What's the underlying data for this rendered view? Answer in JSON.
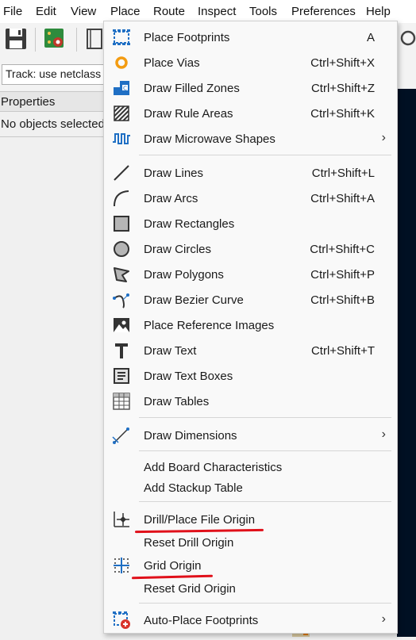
{
  "menubar": {
    "items": [
      {
        "label": "File"
      },
      {
        "label": "Edit"
      },
      {
        "label": "View"
      },
      {
        "label": "Place"
      },
      {
        "label": "Route"
      },
      {
        "label": "Inspect"
      },
      {
        "label": "Tools"
      },
      {
        "label": "Preferences"
      },
      {
        "label": "Help"
      }
    ]
  },
  "track": {
    "value": "Track: use netclass width"
  },
  "properties": {
    "title": "Properties",
    "empty_text": "No objects selected"
  },
  "place_menu": {
    "items": [
      {
        "label": "Place Footprints",
        "shortcut": "A",
        "icon": "footprint-icon"
      },
      {
        "label": "Place Vias",
        "shortcut": "Ctrl+Shift+X",
        "icon": "via-icon"
      },
      {
        "label": "Draw Filled Zones",
        "shortcut": "Ctrl+Shift+Z",
        "icon": "filled-zone-icon"
      },
      {
        "label": "Draw Rule Areas",
        "shortcut": "Ctrl+Shift+K",
        "icon": "rule-area-icon"
      },
      {
        "label": "Draw Microwave Shapes",
        "submenu": true,
        "icon": "microwave-icon"
      },
      {
        "label": "Draw Lines",
        "shortcut": "Ctrl+Shift+L",
        "icon": "line-icon"
      },
      {
        "label": "Draw Arcs",
        "shortcut": "Ctrl+Shift+A",
        "icon": "arc-icon"
      },
      {
        "label": "Draw Rectangles",
        "shortcut": "",
        "icon": "rectangle-icon"
      },
      {
        "label": "Draw Circles",
        "shortcut": "Ctrl+Shift+C",
        "icon": "circle-icon"
      },
      {
        "label": "Draw Polygons",
        "shortcut": "Ctrl+Shift+P",
        "icon": "polygon-icon"
      },
      {
        "label": "Draw Bezier Curve",
        "shortcut": "Ctrl+Shift+B",
        "icon": "bezier-icon"
      },
      {
        "label": "Place Reference Images",
        "shortcut": "",
        "icon": "image-icon"
      },
      {
        "label": "Draw Text",
        "shortcut": "Ctrl+Shift+T",
        "icon": "text-icon"
      },
      {
        "label": "Draw Text Boxes",
        "shortcut": "",
        "icon": "text-box-icon"
      },
      {
        "label": "Draw Tables",
        "shortcut": "",
        "icon": "table-icon"
      },
      {
        "label": "Draw Dimensions",
        "submenu": true,
        "icon": "dimension-icon"
      },
      {
        "label": "Add Board Characteristics",
        "shortcut": ""
      },
      {
        "label": "Add Stackup Table",
        "shortcut": ""
      },
      {
        "label": "Drill/Place File Origin",
        "shortcut": "",
        "icon": "drill-origin-icon"
      },
      {
        "label": "Reset Drill Origin",
        "shortcut": ""
      },
      {
        "label": "Grid Origin",
        "shortcut": "",
        "icon": "grid-origin-icon"
      },
      {
        "label": "Reset Grid Origin",
        "shortcut": ""
      },
      {
        "label": "Auto-Place Footprints",
        "submenu": true,
        "icon": "auto-place-icon"
      }
    ]
  },
  "colors": {
    "accent_blue": "#1f6fc4",
    "via_orange": "#f39c12",
    "annotation_red": "#e0101a",
    "canvas": "#001023"
  }
}
